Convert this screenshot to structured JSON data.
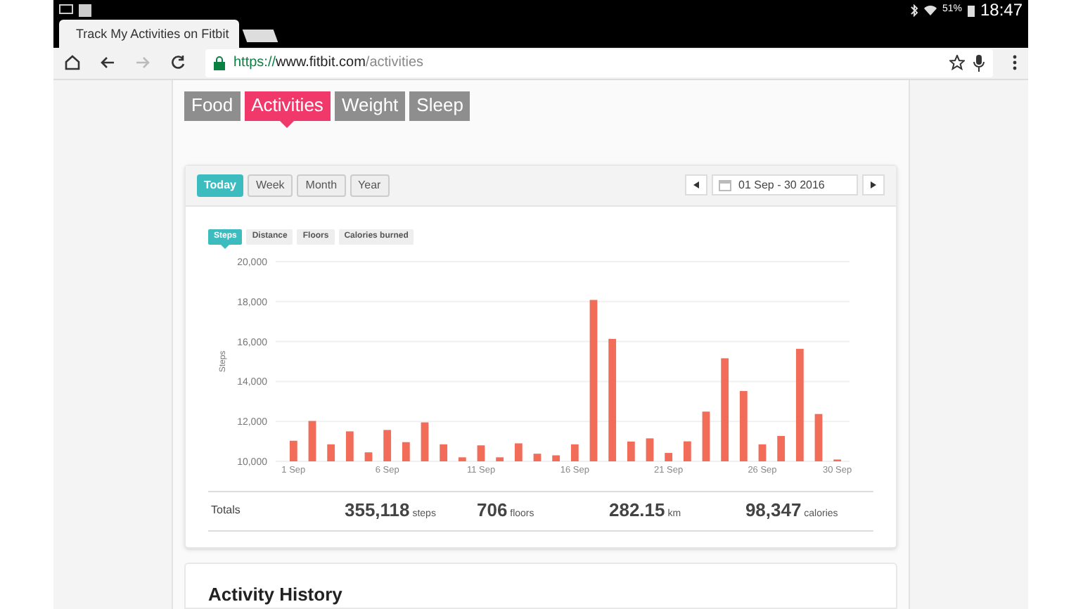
{
  "status_bar": {
    "battery": "51%",
    "time": "18:47"
  },
  "browser": {
    "tab_title": "Track My Activities on Fitbit",
    "url_scheme": "https://",
    "url_host": "www.fitbit.com",
    "url_path": "/activities"
  },
  "nav_tabs": [
    {
      "label": "Food",
      "selected": false
    },
    {
      "label": "Activities",
      "selected": true
    },
    {
      "label": "Weight",
      "selected": false
    },
    {
      "label": "Sleep",
      "selected": false
    }
  ],
  "period_buttons": [
    {
      "label": "Today",
      "selected": true
    },
    {
      "label": "Week",
      "selected": false
    },
    {
      "label": "Month",
      "selected": false
    },
    {
      "label": "Year",
      "selected": false
    }
  ],
  "date_range": "01 Sep - 30 2016",
  "metric_tabs": [
    {
      "label": "Steps",
      "selected": true
    },
    {
      "label": "Distance",
      "selected": false
    },
    {
      "label": "Floors",
      "selected": false
    },
    {
      "label": "Calories burned",
      "selected": false
    }
  ],
  "chart_data": {
    "type": "bar",
    "ylabel": "Steps",
    "grid": true,
    "categories": [
      "1 Sep",
      null,
      null,
      null,
      null,
      "6 Sep",
      null,
      null,
      null,
      null,
      "11 Sep",
      null,
      null,
      null,
      null,
      "16 Sep",
      null,
      null,
      null,
      null,
      "21 Sep",
      null,
      null,
      null,
      null,
      "26 Sep",
      null,
      null,
      null,
      "30 Sep"
    ],
    "ylim": [
      10000,
      20000
    ],
    "yticks": [
      {
        "value": 10000,
        "label": "10,000"
      },
      {
        "value": 12000,
        "label": "12,000"
      },
      {
        "value": 14000,
        "label": "14,000"
      },
      {
        "value": 16000,
        "label": "16,000"
      },
      {
        "value": 18000,
        "label": "18,000"
      },
      {
        "value": 20000,
        "label": "20,000"
      }
    ],
    "series": [
      {
        "color": "#f26c5a",
        "values": [
          11030,
          12020,
          10850,
          11500,
          10450,
          11570,
          10960,
          11950,
          10850,
          10200,
          10800,
          10200,
          10900,
          10380,
          10300,
          10850,
          18080,
          16130,
          10990,
          11150,
          10420,
          11000,
          12490,
          15160,
          13520,
          10850,
          11270,
          15630,
          12370,
          10090
        ]
      }
    ]
  },
  "totals": {
    "label": "Totals",
    "items": [
      {
        "value": "355,118",
        "unit": "steps"
      },
      {
        "value": "706",
        "unit": "floors"
      },
      {
        "value": "282.15",
        "unit": "km"
      },
      {
        "value": "98,347",
        "unit": "calories"
      }
    ]
  },
  "history_title": "Activity History"
}
